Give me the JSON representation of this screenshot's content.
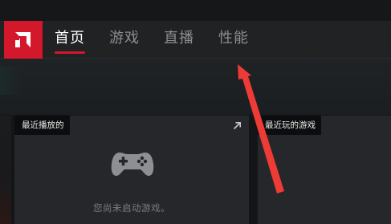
{
  "nav": {
    "tabs": [
      {
        "label": "首页",
        "active": true
      },
      {
        "label": "游戏",
        "active": false
      },
      {
        "label": "直播",
        "active": false
      },
      {
        "label": "性能",
        "active": false
      }
    ]
  },
  "panels": {
    "recent": {
      "title": "最近播放的",
      "empty_message": "您尚未启动游戏。",
      "expand_icon": "expand-arrow-icon",
      "empty_icon": "gamepad-icon"
    },
    "games": {
      "title": "最近玩的游戏"
    }
  },
  "colors": {
    "brand_red": "#d3182b",
    "topbar": "#212224",
    "panel": "#26272a",
    "label_bg": "#0c0d0e",
    "annotation_arrow": "#ee3b36"
  }
}
